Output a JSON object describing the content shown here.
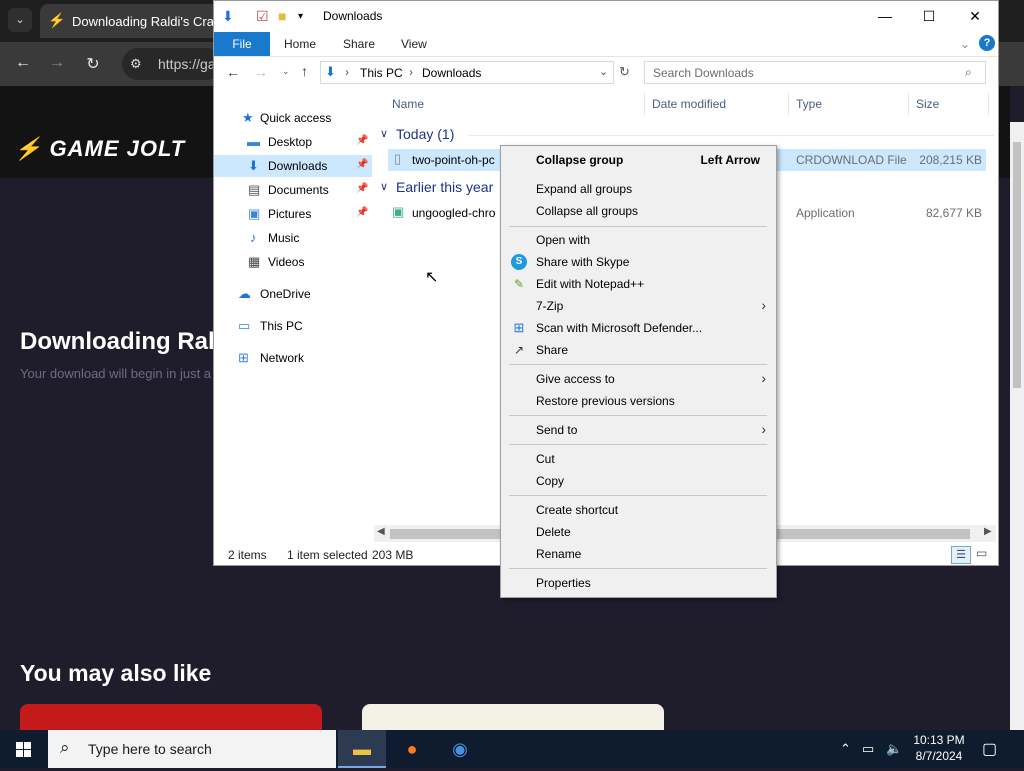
{
  "browser": {
    "tab_title": "Downloading Raldi's Crac",
    "url": "https://ga",
    "brand": "GAME JOLT",
    "page_heading": "Downloading Raldi",
    "page_subtext": "Your download will begin in just a",
    "also_like": "You may also like"
  },
  "explorer": {
    "title": "Downloads",
    "ribbon_tabs": [
      "File",
      "Home",
      "Share",
      "View"
    ],
    "breadcrumb": [
      "This PC",
      "Downloads"
    ],
    "search_placeholder": "Search Downloads",
    "nav_items": [
      {
        "label": "Quick access",
        "icon": "star-icon"
      },
      {
        "label": "Desktop",
        "icon": "desktop-icon",
        "pinned": true
      },
      {
        "label": "Downloads",
        "icon": "download-icon",
        "pinned": true
      },
      {
        "label": "Documents",
        "icon": "documents-icon",
        "pinned": true
      },
      {
        "label": "Pictures",
        "icon": "pictures-icon",
        "pinned": true
      },
      {
        "label": "Music",
        "icon": "music-icon"
      },
      {
        "label": "Videos",
        "icon": "videos-icon"
      },
      {
        "label": "OneDrive",
        "icon": "cloud-icon"
      },
      {
        "label": "This PC",
        "icon": "computer-icon"
      },
      {
        "label": "Network",
        "icon": "network-icon"
      }
    ],
    "columns": [
      "Name",
      "Date modified",
      "Type",
      "Size"
    ],
    "groups": [
      {
        "title": "Today (1)",
        "files": [
          {
            "name": "two-point-oh-pc",
            "type": "CRDOWNLOAD File",
            "size": "208,215 KB"
          }
        ]
      },
      {
        "title": "Earlier this year",
        "files": [
          {
            "name": "ungoogled-chro",
            "type": "Application",
            "size": "82,677 KB"
          }
        ]
      }
    ],
    "status": {
      "items": "2 items",
      "selected": "1 item selected",
      "size": "203 MB"
    }
  },
  "context_menu": {
    "collapse_group": "Collapse group",
    "collapse_group_accel": "Left Arrow",
    "expand_all": "Expand all groups",
    "collapse_all": "Collapse all groups",
    "open_with": "Open with",
    "share_skype": "Share with Skype",
    "edit_notepad": "Edit with Notepad++",
    "seven_zip": "7-Zip",
    "scan_defender": "Scan with Microsoft Defender...",
    "share": "Share",
    "give_access": "Give access to",
    "restore_versions": "Restore previous versions",
    "send_to": "Send to",
    "cut": "Cut",
    "copy": "Copy",
    "create_shortcut": "Create shortcut",
    "delete": "Delete",
    "rename": "Rename",
    "properties": "Properties"
  },
  "taskbar": {
    "search_placeholder": "Type here to search",
    "time": "10:13 PM",
    "date": "8/7/2024"
  }
}
